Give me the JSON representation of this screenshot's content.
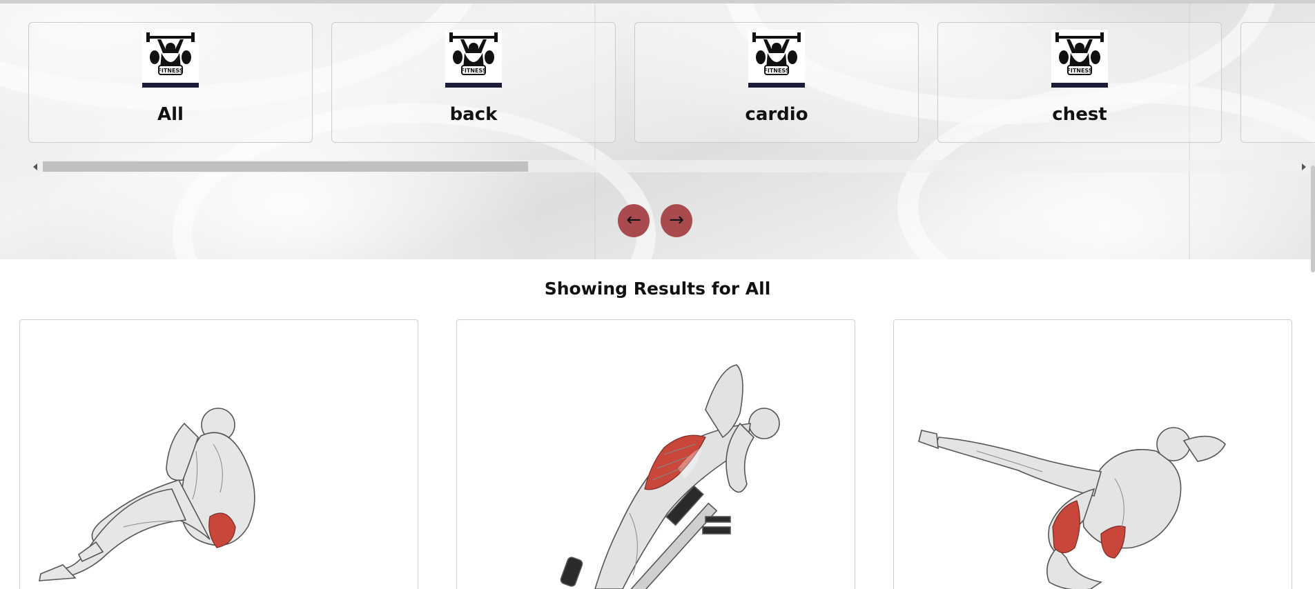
{
  "categories": {
    "items": [
      {
        "label": "All",
        "logo": "fitness-logo"
      },
      {
        "label": "back",
        "logo": "fitness-logo"
      },
      {
        "label": "cardio",
        "logo": "fitness-logo"
      },
      {
        "label": "chest",
        "logo": "fitness-logo"
      },
      {
        "label": "",
        "logo": ""
      }
    ],
    "logo_text": "FITNESS"
  },
  "navigation": {
    "prev_label": "←",
    "next_label": "→",
    "button_color": "#a94a4e"
  },
  "results": {
    "title": "Showing Results for All"
  },
  "exercises": [
    {
      "image": "seated-crunch-illustration"
    },
    {
      "image": "decline-bench-oblique-crunch-illustration"
    },
    {
      "image": "bicycle-crunch-illustration"
    }
  ],
  "colors": {
    "muscle_highlight": "#c9463a",
    "card_border": "#cbcbcb"
  }
}
